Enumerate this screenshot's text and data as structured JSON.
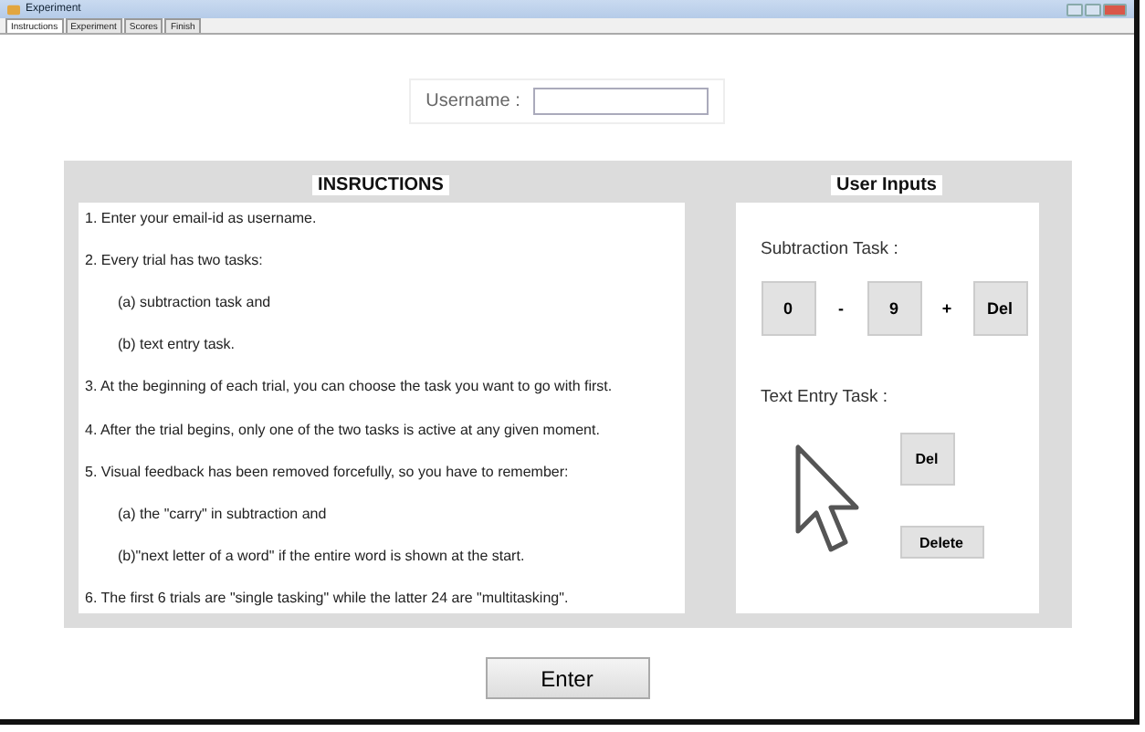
{
  "window": {
    "title": "Experiment"
  },
  "tabs": [
    {
      "label": "Instructions",
      "selected": true
    },
    {
      "label": "Experiment",
      "selected": false
    },
    {
      "label": "Scores",
      "selected": false
    },
    {
      "label": "Finish",
      "selected": false
    }
  ],
  "username": {
    "label": "Username :"
  },
  "instructions": {
    "heading": "INSRUCTIONS",
    "items": [
      {
        "text": "1. Enter your email-id as username."
      },
      {
        "text": "2. Every trial has two tasks:",
        "children": [
          {
            "text": "(a) subtraction task and"
          },
          {
            "text": "(b) text entry task."
          }
        ]
      },
      {
        "text": "3. At the beginning of each trial, you can choose the task you want to go with first."
      },
      {
        "text": "4. After the trial begins, only one of the two tasks is active at any given moment."
      },
      {
        "text": "5. Visual feedback has been removed forcefully, so you have to remember:",
        "children": [
          {
            "text": "(a) the \"carry\" in subtraction and"
          },
          {
            "text": "(b)\"next letter of a word\" if the entire word is shown at the start."
          }
        ]
      },
      {
        "text": "6. The first 6 trials are \"single tasking\" while the latter 24 are \"multitasking\"."
      }
    ]
  },
  "user_inputs": {
    "heading": "User Inputs",
    "subtraction": {
      "label": "Subtraction Task :",
      "parts": [
        {
          "kind": "key",
          "text": "0"
        },
        {
          "kind": "sign",
          "text": "-"
        },
        {
          "kind": "key",
          "text": "9"
        },
        {
          "kind": "sign",
          "text": "+"
        },
        {
          "kind": "key",
          "text": "Del"
        }
      ]
    },
    "text_entry": {
      "label": "Text Entry Task :",
      "buttons": [
        "Del",
        "Delete"
      ]
    }
  },
  "enter_button": "Enter"
}
